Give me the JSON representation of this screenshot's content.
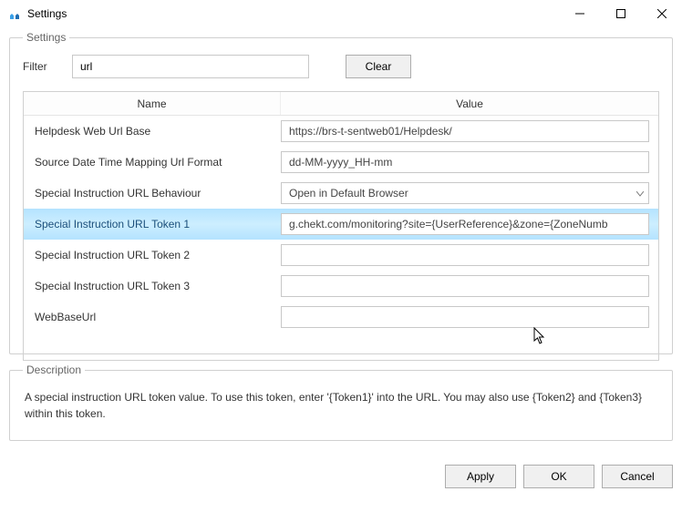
{
  "window": {
    "title": "Settings",
    "minimize_tip": "Minimize",
    "maximize_tip": "Maximize",
    "close_tip": "Close"
  },
  "settings_panel": {
    "legend": "Settings",
    "filter_label": "Filter",
    "filter_value": "url",
    "clear_label": "Clear",
    "columns": {
      "name": "Name",
      "value": "Value"
    },
    "rows": [
      {
        "name": "Helpdesk Web Url Base",
        "type": "text",
        "value": "https://brs-t-sentweb01/Helpdesk/"
      },
      {
        "name": "Source Date Time Mapping Url Format",
        "type": "text",
        "value": "dd-MM-yyyy_HH-mm"
      },
      {
        "name": "Special Instruction URL Behaviour",
        "type": "select",
        "value": "Open in Default Browser"
      },
      {
        "name": "Special Instruction URL Token 1",
        "type": "text",
        "value": "g.chekt.com/monitoring?site={UserReference}&zone={ZoneNumb",
        "selected": true
      },
      {
        "name": "Special Instruction URL Token 2",
        "type": "text",
        "value": ""
      },
      {
        "name": "Special Instruction URL Token 3",
        "type": "text",
        "value": ""
      },
      {
        "name": "WebBaseUrl",
        "type": "text",
        "value": ""
      }
    ]
  },
  "description_panel": {
    "legend": "Description",
    "text": "A special instruction URL token value. To use this token, enter '{Token1}' into the URL. You may also use {Token2} and {Token3} within this token."
  },
  "footer": {
    "apply": "Apply",
    "ok": "OK",
    "cancel": "Cancel"
  }
}
